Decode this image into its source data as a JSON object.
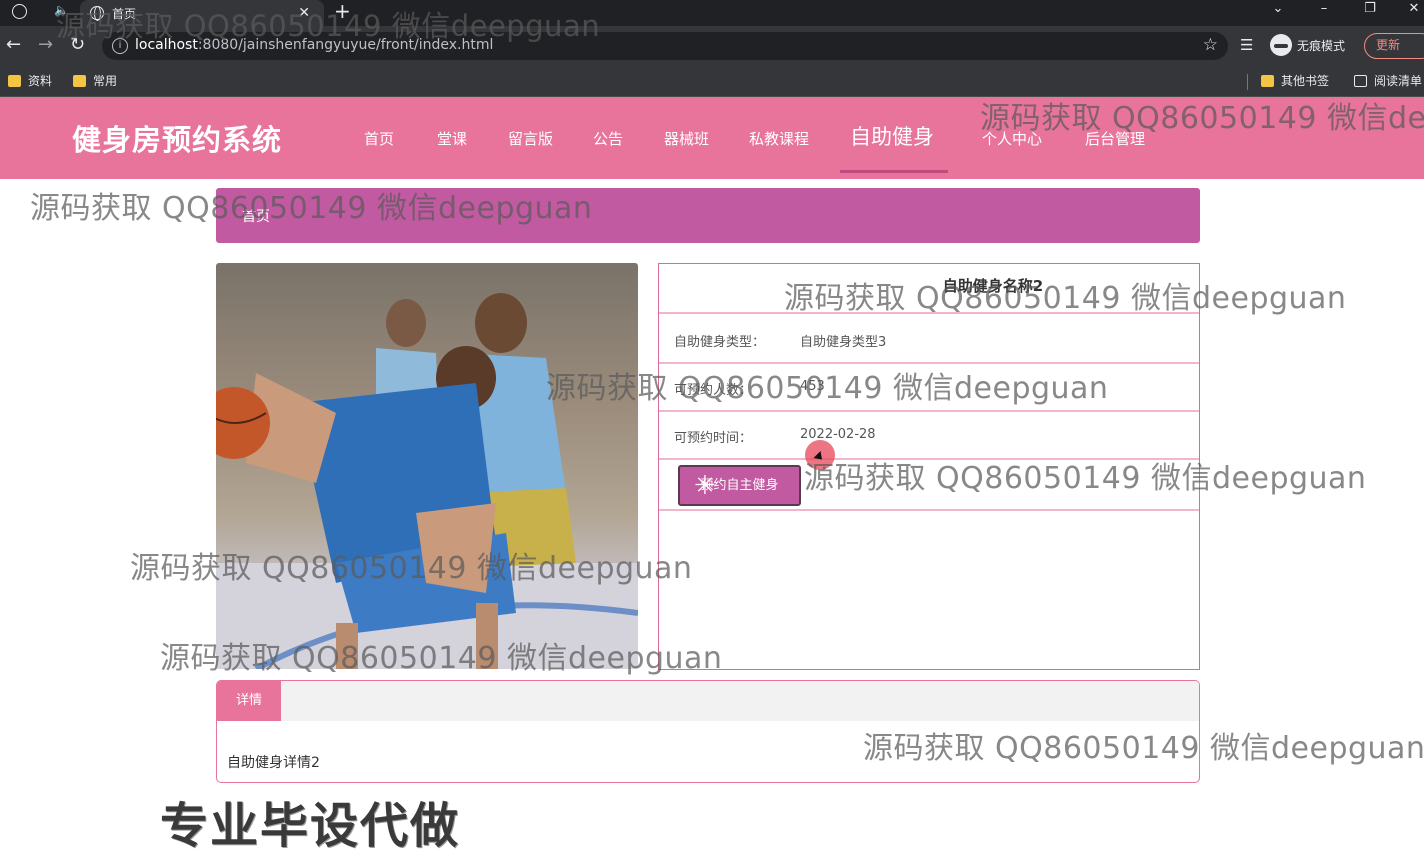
{
  "browser": {
    "tab_title": "首页",
    "url_host": "localhost",
    "url_rest": ":8080/jainshenfangyuyue/front/index.html",
    "incognito_label": "无痕模式",
    "update_label": "更新",
    "bookmarks": [
      "资料",
      "常用"
    ],
    "other_bookmarks": "其他书签",
    "reading_list": "阅读清单"
  },
  "site": {
    "logo": "健身房预约系统",
    "nav": [
      "首页",
      "堂课",
      "留言版",
      "公告",
      "器械班",
      "私教课程",
      "自助健身",
      "个人中心",
      "后台管理"
    ],
    "active_nav": "自助健身"
  },
  "breadcrumb": "首页",
  "detail": {
    "title": "自助健身名称2",
    "fields": [
      {
        "label": "自助健身类型：",
        "value": "自助健身类型3"
      },
      {
        "label": "可预约人数：",
        "value": "453"
      },
      {
        "label": "可预约时间：",
        "value": "2022-02-28"
      }
    ],
    "book_button": "预约自主健身"
  },
  "description": {
    "tab": "详情",
    "text": "自助健身详情2"
  },
  "watermark": "源码获取 QQ86050149 微信deepguan",
  "promo": "专业毕设代做",
  "colors": {
    "header": "#e8749c",
    "breadcrumb": "#c25aa1",
    "accent_border": "#d86b97"
  }
}
